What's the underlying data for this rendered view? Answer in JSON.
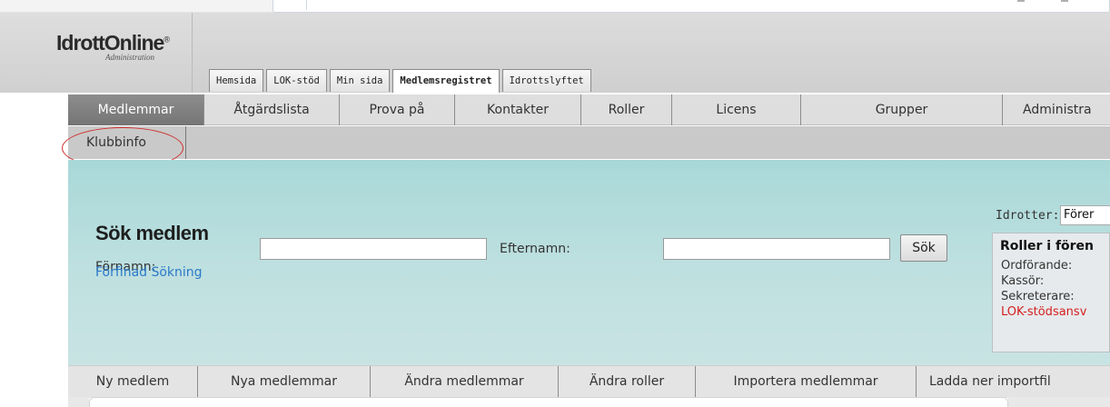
{
  "app": {
    "logo_name": "IdrottOnline",
    "logo_reg": "®",
    "logo_sub": "Administration"
  },
  "top_tabs": [
    {
      "label": "Hemsida",
      "active": false
    },
    {
      "label": "LOK-stöd",
      "active": false
    },
    {
      "label": "Min sida",
      "active": false
    },
    {
      "label": "Medlemsregistret",
      "active": true
    },
    {
      "label": "Idrottslyftet",
      "active": false
    }
  ],
  "main_nav": [
    {
      "label": "Medlemmar",
      "active": true
    },
    {
      "label": "Åtgärdslista",
      "active": false
    },
    {
      "label": "Prova på",
      "active": false
    },
    {
      "label": "Kontakter",
      "active": false
    },
    {
      "label": "Roller",
      "active": false
    },
    {
      "label": "Licens",
      "active": false
    },
    {
      "label": "Grupper",
      "active": false
    },
    {
      "label": "Administra",
      "active": false
    }
  ],
  "sub_nav": {
    "label": "Klubbinfo"
  },
  "search": {
    "title": "Sök medlem",
    "firstname_label": "Förnamn:",
    "firstname_value": "",
    "lastname_label": "Efternamn:",
    "lastname_value": "",
    "button_label": "Sök",
    "advanced_link": "Förfinad Sökning"
  },
  "sports": {
    "label": "Idrotter:",
    "selected": "Förer"
  },
  "roles": {
    "title": "Roller i fören",
    "rows": [
      {
        "label": "Ordförande:"
      },
      {
        "label": "Kassör:"
      },
      {
        "label": "Sekreterare:"
      },
      {
        "label": "LOK-stödsansv"
      }
    ]
  },
  "bottom_tabs": [
    {
      "label": "Ny medlem"
    },
    {
      "label": "Nya medlemmar"
    },
    {
      "label": "Ändra medlemmar"
    },
    {
      "label": "Ändra roller"
    },
    {
      "label": "Importera medlemmar"
    },
    {
      "label": "Ladda ner importfil"
    }
  ],
  "colors": {
    "panel": "#bfe0e0",
    "active_nav": "#7f7f7f",
    "link": "#2b79c9",
    "highlight_circle": "#d0302d"
  }
}
